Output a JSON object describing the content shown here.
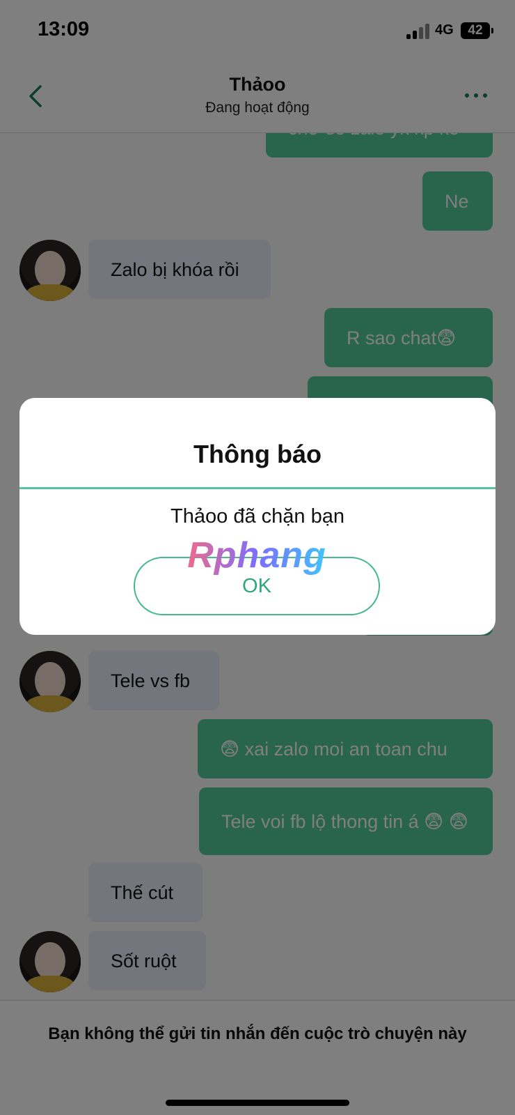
{
  "status_bar": {
    "time": "13:09",
    "network": "4G",
    "battery": "42"
  },
  "header": {
    "contact_name": "Thảoo",
    "contact_status": "Đang hoạt động"
  },
  "messages": [
    {
      "from": "me",
      "text": "chờ số zalo yk kp ke"
    },
    {
      "from": "me",
      "text": "Ne"
    },
    {
      "from": "them",
      "text": "Zalo bị khóa rồi",
      "avatar": true
    },
    {
      "from": "me",
      "text": "R sao chat😨"
    },
    {
      "from": "me",
      "text": ""
    },
    {
      "from": "me",
      "text": ""
    },
    {
      "from": "them",
      "text": "Tele vs fb",
      "avatar": true
    },
    {
      "from": "me",
      "text": "😨 xai zalo moi an toan chu"
    },
    {
      "from": "me",
      "text": "Tele voi fb lộ thong tin á 😨 😨"
    },
    {
      "from": "them",
      "text": "Thế cút"
    },
    {
      "from": "them",
      "text": "Sốt ruột",
      "avatar": true
    }
  ],
  "footer": {
    "notice": "Bạn không thể gửi tin nhắn đến cuộc trò chuyện này"
  },
  "dialog": {
    "title": "Thông báo",
    "message": "Thảoo đã chặn bạn",
    "ok_label": "OK",
    "watermark": "Rphang"
  },
  "colors": {
    "sent_bubble": "#52c99a",
    "received_bubble": "#e7eefb",
    "accent": "#1a7a58",
    "ok_button": "#45b88c"
  }
}
